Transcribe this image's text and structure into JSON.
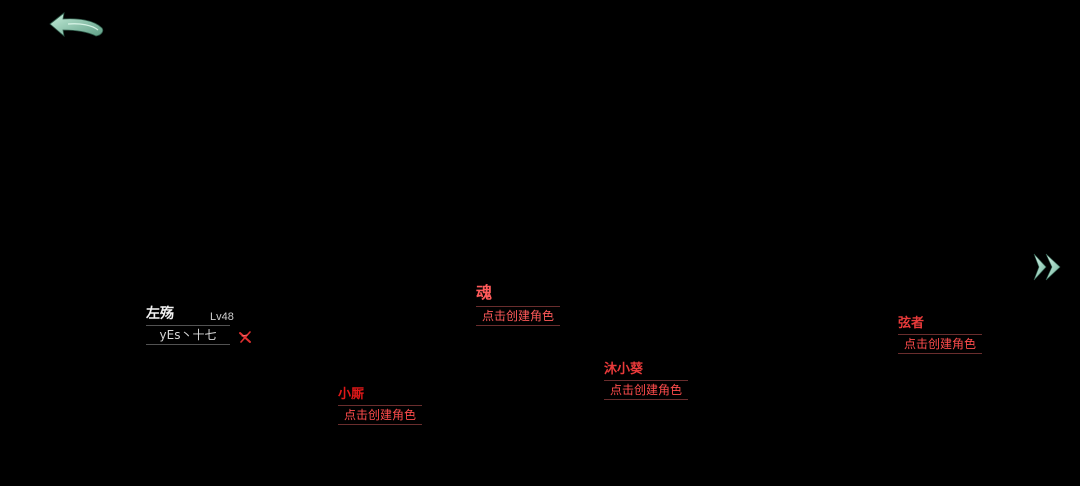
{
  "navigation": {
    "back_icon": "back-arrow-icon",
    "next_icon": "double-chevron-right-icon"
  },
  "colors": {
    "background": "#000000",
    "accent_jade": "#8fd0b4",
    "empty_slot_red": "#ff4c4c",
    "existing_name": "#f2f2f2"
  },
  "characters": [
    {
      "class_name": "左殇",
      "level": "Lv48",
      "player_name": "yEs丶十七",
      "delete_icon": "delete-mark-icon"
    }
  ],
  "empty_slots": [
    {
      "class_name": "魂",
      "action_label": "点击创建角色"
    },
    {
      "class_name": "小厮",
      "action_label": "点击创建角色"
    },
    {
      "class_name": "沐小葵",
      "action_label": "点击创建角色"
    },
    {
      "class_name": "弦者",
      "action_label": "点击创建角色"
    }
  ]
}
